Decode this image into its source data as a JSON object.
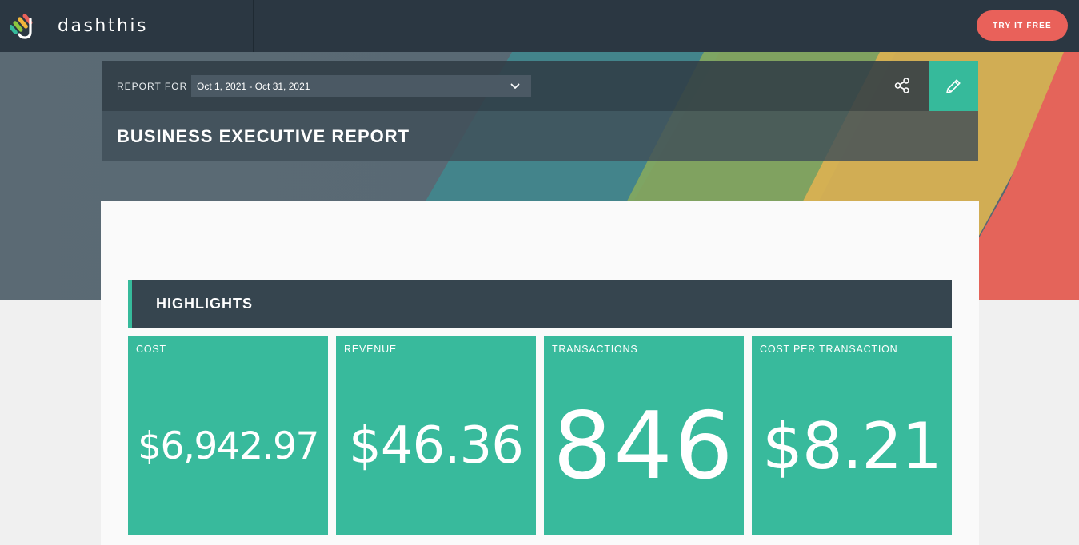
{
  "brand": {
    "name": "dashthis",
    "colors": {
      "teal": "#36ba9b",
      "coral": "#e9615a",
      "navy": "#2b3742"
    }
  },
  "topbar": {
    "cta_label": "TRY IT FREE"
  },
  "report": {
    "report_for_label": "REPORT FOR",
    "date_range": "Oct 1, 2021 - Oct 31, 2021",
    "title": "BUSINESS EXECUTIVE REPORT",
    "icons": {
      "date_select": "chevron-down-icon",
      "share": "share-icon",
      "edit": "pencil-icon"
    }
  },
  "section": {
    "title": "HIGHLIGHTS"
  },
  "kpis": [
    {
      "label": "COST",
      "value": "$6,942.97"
    },
    {
      "label": "REVENUE",
      "value": "$46.36"
    },
    {
      "label": "TRANSACTIONS",
      "value": "846"
    },
    {
      "label": "COST PER TRANSACTION",
      "value": "$8.21"
    }
  ]
}
